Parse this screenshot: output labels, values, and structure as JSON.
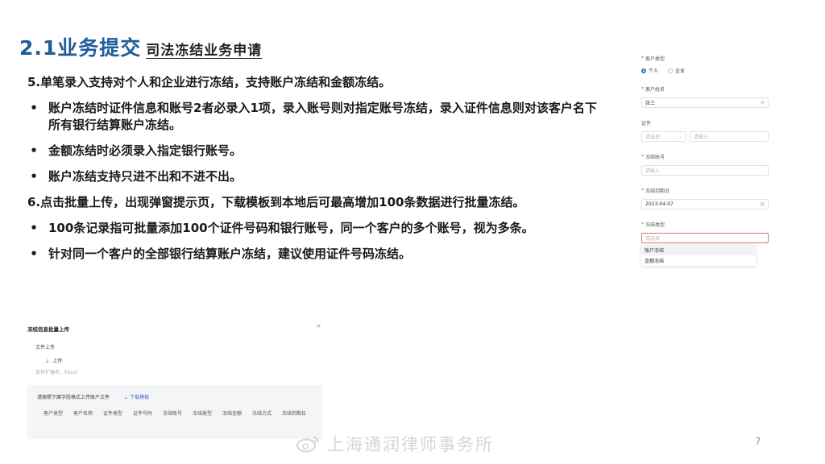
{
  "title": {
    "main": "2.1业务提交",
    "sub": "司法冻结业务申请"
  },
  "content": [
    {
      "kind": "num",
      "text": "5.单笔录入支持对个人和企业进行冻结，支持账户冻结和金额冻结。"
    },
    {
      "kind": "bul",
      "bullet": "•",
      "text": "账户冻结时证件信息和账号2者必录入1项，录入账号则对指定账号冻结，录入证件信息则对该客户名下所有银行结算账户冻结。"
    },
    {
      "kind": "bul",
      "bullet": "•",
      "text": "金额冻结时必须录入指定银行账号。"
    },
    {
      "kind": "bul",
      "bullet": "•",
      "text": "账户冻结支持只进不出和不进不出。"
    },
    {
      "kind": "num",
      "text": "6.点击批量上传，出现弹窗提示页，下载模板到本地后可最高增加100条数据进行批量冻结。"
    },
    {
      "kind": "bul",
      "bullet": "•",
      "text": "100条记录指可批量添加100个证件号码和银行账号，同一个客户的多个账号，视为多条。"
    },
    {
      "kind": "bul",
      "bullet": "•",
      "text": "针对同一个客户的全部银行结算账户冻结，建议使用证件号码冻结。"
    }
  ],
  "form": {
    "required_mark": "*",
    "customer_type": {
      "label": "客户类型",
      "options": [
        "个人",
        "企业"
      ],
      "selected": "个人"
    },
    "customer_name": {
      "label": "客户姓名",
      "value": "张三"
    },
    "certificate": {
      "label": "证件",
      "select_placeholder": "请选择",
      "input_placeholder": "请输入"
    },
    "freeze_account": {
      "label": "冻结账号",
      "placeholder": "请输入"
    },
    "freeze_expiry": {
      "label": "冻结到期日",
      "value": "2023-04-07"
    },
    "freeze_type": {
      "label": "冻结类型",
      "placeholder": "请选择",
      "options": [
        "账户冻结",
        "金额冻结"
      ]
    }
  },
  "modal": {
    "title": "冻结信息批量上传",
    "close": "×",
    "file_label": "文件上传",
    "upload_label": "上传",
    "upload_icon": "⊥",
    "hint": "支持扩展名：Excel",
    "tip": "请按照下面字段格式上传账户文件",
    "download_icon": "⊥",
    "download_label": "下载模板",
    "columns": [
      "客户类型",
      "客户名称",
      "证件类型",
      "证件号码",
      "冻结账号",
      "冻结类型",
      "冻结金额",
      "冻结方式",
      "冻结到期日"
    ]
  },
  "footer": {
    "watermark": "上海通润律师事务所",
    "page_number": "7"
  },
  "colors": {
    "title": "#1f5d99",
    "accent": "#3b6bd8",
    "required": "#e5484d",
    "error_border": "#e86c6c"
  }
}
